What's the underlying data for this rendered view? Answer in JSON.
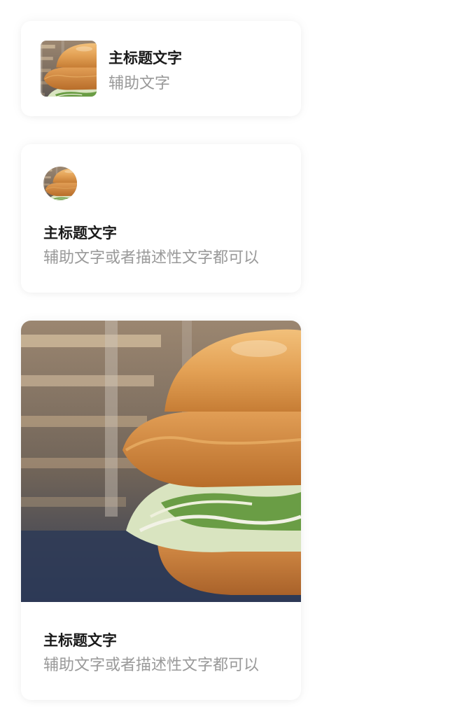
{
  "cards": [
    {
      "title": "主标题文字",
      "subtitle": "辅助文字",
      "image": "burger-photo"
    },
    {
      "title": "主标题文字",
      "subtitle": "辅助文字或者描述性文字都可以",
      "image": "burger-photo"
    },
    {
      "title": "主标题文字",
      "subtitle": "辅助文字或者描述性文字都可以",
      "image": "burger-photo"
    }
  ]
}
